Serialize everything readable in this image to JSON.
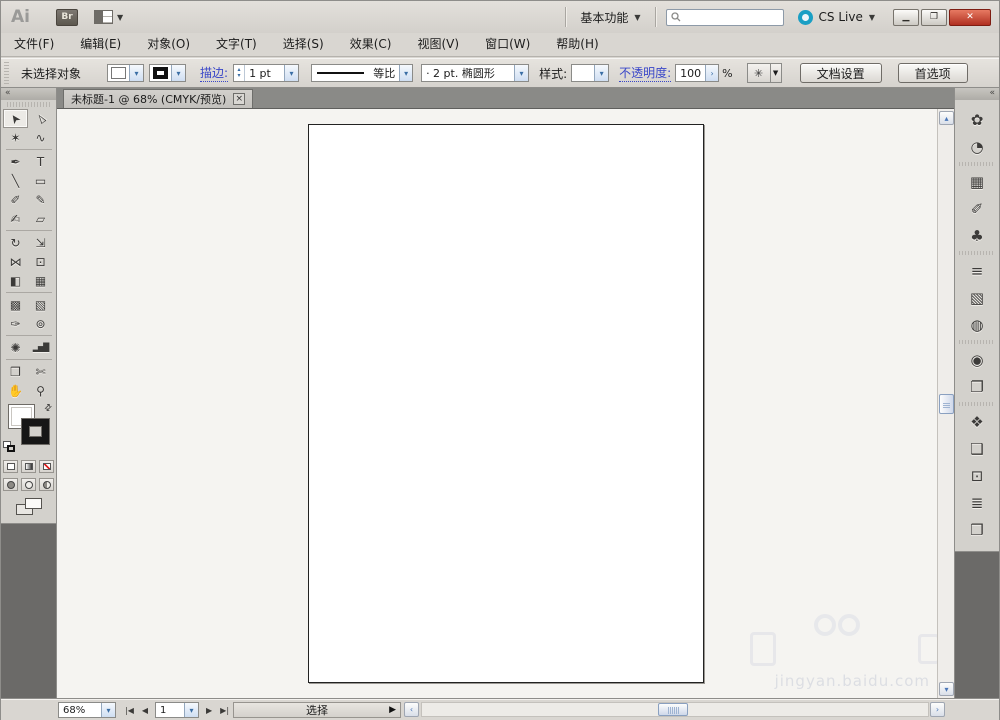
{
  "titlebar": {
    "app_logo": "Ai",
    "bridge_button": "Br",
    "workspace_switcher": "基本功能",
    "search_value": "",
    "cs_live": "CS Live"
  },
  "icons": {
    "dropdown_arrow": "▼",
    "chevron_down": "▾",
    "chevron_up": "▴",
    "chevron_left": "‹",
    "chevron_right": "›",
    "spinner_up": "▴",
    "spinner_down": "▾",
    "collapse_double_arrow": "«",
    "swap_arrows": "⇄",
    "magic_wand": "✳",
    "minimize": "▁",
    "restore": "❐",
    "close": "✕",
    "tab_close": "×",
    "status_arrow": "▶",
    "nav_first": "|◀",
    "nav_prev": "◀",
    "nav_next": "▶",
    "nav_last": "▶|",
    "scroll_up": "▴",
    "scroll_down": "▾"
  },
  "menubar": {
    "items": [
      "文件(F)",
      "编辑(E)",
      "对象(O)",
      "文字(T)",
      "选择(S)",
      "效果(C)",
      "视图(V)",
      "窗口(W)",
      "帮助(H)"
    ]
  },
  "controlbar": {
    "selection_status": "未选择对象",
    "stroke_label": "描边:",
    "stroke_weight": "1 pt",
    "profile_label": "等比",
    "brush_label": "· 2 pt. 椭圆形",
    "style_label": "样式:",
    "opacity_label": "不透明度:",
    "opacity_value": "100",
    "percent_sign": "%",
    "document_setup_button": "文档设置",
    "preferences_button": "首选项"
  },
  "document_tab": {
    "title": "未标题-1 @ 68% (CMYK/预览)"
  },
  "toolbar": {
    "tools": [
      {
        "name": "selection-tool",
        "glyph": "➤",
        "rot": -125,
        "selected": true
      },
      {
        "name": "direct-selection-tool",
        "glyph": "▻",
        "rot": -125
      },
      {
        "name": "magic-wand-tool",
        "glyph": "✶"
      },
      {
        "name": "lasso-tool",
        "glyph": "∿"
      },
      {
        "sep": true
      },
      {
        "name": "pen-tool",
        "glyph": "✒"
      },
      {
        "name": "type-tool",
        "glyph": "T"
      },
      {
        "name": "line-segment-tool",
        "glyph": "╲"
      },
      {
        "name": "rectangle-tool",
        "glyph": "▭"
      },
      {
        "name": "paintbrush-tool",
        "glyph": "✐"
      },
      {
        "name": "pencil-tool",
        "glyph": "✎"
      },
      {
        "name": "blob-brush-tool",
        "glyph": "✍"
      },
      {
        "name": "eraser-tool",
        "glyph": "▱"
      },
      {
        "sep": true
      },
      {
        "name": "rotate-tool",
        "glyph": "↻"
      },
      {
        "name": "scale-tool",
        "glyph": "⇲"
      },
      {
        "name": "width-tool",
        "glyph": "⋈"
      },
      {
        "name": "free-transform-tool",
        "glyph": "⊡"
      },
      {
        "name": "shape-builder-tool",
        "glyph": "◧"
      },
      {
        "name": "perspective-grid-tool",
        "glyph": "▦"
      },
      {
        "sep": true
      },
      {
        "name": "mesh-tool",
        "glyph": "▩"
      },
      {
        "name": "gradient-tool",
        "glyph": "▧"
      },
      {
        "name": "eyedropper-tool",
        "glyph": "✑"
      },
      {
        "name": "blend-tool",
        "glyph": "⊚"
      },
      {
        "sep": true
      },
      {
        "name": "symbol-sprayer-tool",
        "glyph": "✺"
      },
      {
        "name": "column-graph-tool",
        "glyph": "▂▅█",
        "small": true
      },
      {
        "sep": true
      },
      {
        "name": "artboard-tool",
        "glyph": "❒"
      },
      {
        "name": "slice-tool",
        "glyph": "✄"
      },
      {
        "name": "hand-tool",
        "glyph": "✋"
      },
      {
        "name": "zoom-tool",
        "glyph": "⚲"
      }
    ]
  },
  "panels_right": {
    "icons": [
      {
        "name": "color-panel",
        "glyph": "✿"
      },
      {
        "name": "color-guide-panel",
        "glyph": "◔"
      },
      {
        "sep": true
      },
      {
        "name": "swatches-panel",
        "glyph": "▦"
      },
      {
        "name": "brushes-panel",
        "glyph": "✐"
      },
      {
        "name": "symbols-panel",
        "glyph": "♣"
      },
      {
        "sep": true
      },
      {
        "name": "stroke-panel",
        "glyph": "≡"
      },
      {
        "name": "gradient-panel",
        "glyph": "▧"
      },
      {
        "name": "transparency-panel",
        "glyph": "◍"
      },
      {
        "sep": true
      },
      {
        "name": "appearance-panel",
        "glyph": "◉"
      },
      {
        "name": "graphic-styles-panel",
        "glyph": "❐"
      },
      {
        "sep": true
      },
      {
        "name": "layers-panel",
        "glyph": "❖"
      },
      {
        "name": "artboards-panel",
        "glyph": "❑"
      },
      {
        "name": "transform-panel",
        "glyph": "⊡"
      },
      {
        "name": "align-panel",
        "glyph": "≣"
      },
      {
        "name": "pathfinder-panel",
        "glyph": "❒"
      }
    ]
  },
  "statusbar": {
    "zoom_level": "68%",
    "artboard_number": "1",
    "status_text": "选择"
  },
  "watermark": {
    "text": "jingyan.baidu.com"
  },
  "colors": {
    "accent_link": "#3946c8",
    "scroll_arrow_blue": "#4a76b8",
    "cs_live_teal": "#1a9fc4",
    "close_button_red": "#b03021",
    "tab_strip_gray": "#8a8a87",
    "dock_dark_gray": "#6b6a68",
    "canvas_bg": "#f5f4f1"
  }
}
